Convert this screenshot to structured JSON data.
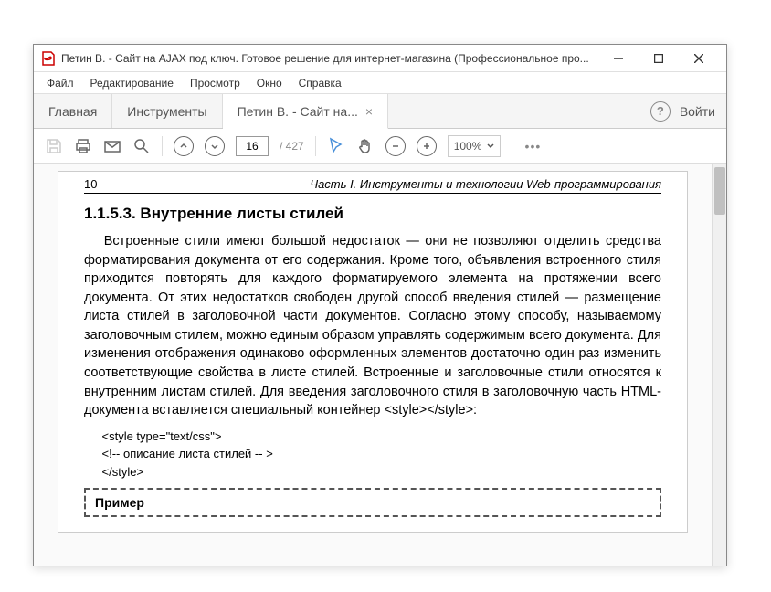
{
  "window": {
    "title": "Петин В. - Сайт на AJAX под ключ. Готовое решение для интернет-магазина (Профессиональное про..."
  },
  "menu": {
    "file": "Файл",
    "edit": "Редактирование",
    "view": "Просмотр",
    "window": "Окно",
    "help": "Справка"
  },
  "tabs": {
    "home": "Главная",
    "tools": "Инструменты",
    "doc": "Петин В. - Сайт на...",
    "login": "Войти"
  },
  "toolbar": {
    "page_current": "16",
    "page_total": "/ 427",
    "zoom": "100%"
  },
  "doc": {
    "page_num": "10",
    "part_title": "Часть I. Инструменты и технологии Web-программирования",
    "section": "1.1.5.3. Внутренние листы стилей",
    "para": "Встроенные стили имеют большой недостаток — они не позволяют отделить средства форматирования документа от его содержания. Кроме того, объявления встроенного стиля приходится повторять для каждого форматируемого элемента на протяжении всего документа. От этих недостатков свободен другой способ введения стилей — размещение листа стилей в заголовочной части документов. Согласно этому способу, называемому заголовочным стилем, можно единым образом управлять содержимым всего документа. Для изменения отображения одинаково оформленных элементов достаточно один раз изменить соответствующие свойства в листе стилей. Встроенные и заголовочные стили относятся к внутренним листам стилей. Для введения заголовочного стиля в заголовочную часть HTML-документа вставляется специальный контейнер <style></style>:",
    "code1": "<style type=\"text/css\">",
    "code2": "<!-- описание листа стилей -- >",
    "code3": "</style>",
    "example_label": "Пример"
  }
}
